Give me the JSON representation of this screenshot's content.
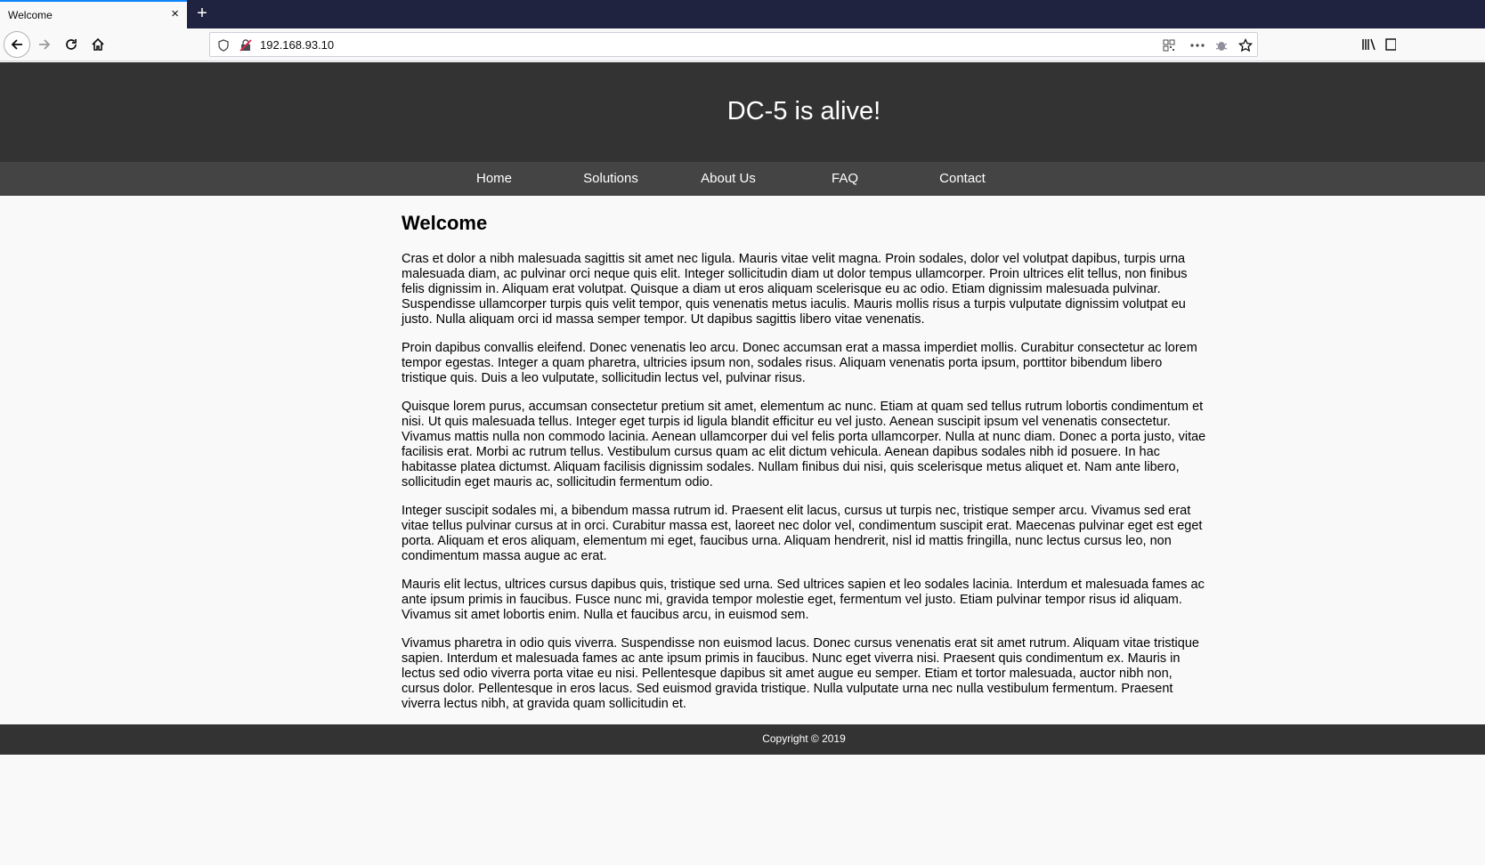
{
  "browser": {
    "tab_title": "Welcome",
    "tab_close": "×",
    "new_tab": "+",
    "url": "192.168.93.10",
    "icons": [
      "back-arrow-icon",
      "forward-arrow-icon",
      "reload-icon",
      "home-icon",
      "shield-icon",
      "insecure-lock-icon",
      "qr-code-icon",
      "more-icon",
      "bug-icon",
      "star-icon",
      "library-icon",
      "sidebar-icon"
    ]
  },
  "site": {
    "title": "DC-5 is alive!",
    "nav": [
      "Home",
      "Solutions",
      "About Us",
      "FAQ",
      "Contact"
    ],
    "heading": "Welcome",
    "paragraphs": [
      "Cras et dolor a nibh malesuada sagittis sit amet nec ligula. Mauris vitae velit magna. Proin sodales, dolor vel volutpat dapibus, turpis urna malesuada diam, ac pulvinar orci neque quis elit. Integer sollicitudin diam ut dolor tempus ullamcorper. Proin ultrices elit tellus, non finibus felis dignissim in. Aliquam erat volutpat. Quisque a diam ut eros aliquam scelerisque eu ac odio. Etiam dignissim malesuada pulvinar. Suspendisse ullamcorper turpis quis velit tempor, quis venenatis metus iaculis. Mauris mollis risus a turpis vulputate dignissim volutpat eu justo. Nulla aliquam orci id massa semper tempor. Ut dapibus sagittis libero vitae venenatis.",
      "Proin dapibus convallis eleifend. Donec venenatis leo arcu. Donec accumsan erat a massa imperdiet mollis. Curabitur consectetur ac lorem tempor egestas. Integer a quam pharetra, ultricies ipsum non, sodales risus. Aliquam venenatis porta ipsum, porttitor bibendum libero tristique quis. Duis a leo vulputate, sollicitudin lectus vel, pulvinar risus.",
      "Quisque lorem purus, accumsan consectetur pretium sit amet, elementum ac nunc. Etiam at quam sed tellus rutrum lobortis condimentum et nisi. Ut quis malesuada tellus. Integer eget turpis id ligula blandit efficitur eu vel justo. Aenean suscipit ipsum vel venenatis consectetur. Vivamus mattis nulla non commodo lacinia. Aenean ullamcorper dui vel felis porta ullamcorper. Nulla at nunc diam. Donec a porta justo, vitae facilisis erat. Morbi ac rutrum tellus. Vestibulum cursus quam ac elit dictum vehicula. Aenean dapibus sodales nibh id posuere. In hac habitasse platea dictumst. Aliquam facilisis dignissim sodales. Nullam finibus dui nisi, quis scelerisque metus aliquet et. Nam ante libero, sollicitudin eget mauris ac, sollicitudin fermentum odio.",
      "Integer suscipit sodales mi, a bibendum massa rutrum id. Praesent elit lacus, cursus ut turpis nec, tristique semper arcu. Vivamus sed erat vitae tellus pulvinar cursus at in orci. Curabitur massa est, laoreet nec dolor vel, condimentum suscipit erat. Maecenas pulvinar eget est eget porta. Aliquam et eros aliquam, elementum mi eget, faucibus urna. Aliquam hendrerit, nisl id mattis fringilla, nunc lectus cursus leo, non condimentum massa augue ac erat.",
      "Mauris elit lectus, ultrices cursus dapibus quis, tristique sed urna. Sed ultrices sapien et leo sodales lacinia. Interdum et malesuada fames ac ante ipsum primis in faucibus. Fusce nunc mi, gravida tempor molestie eget, fermentum vel justo. Etiam pulvinar tempor risus id aliquam. Vivamus sit amet lobortis enim. Nulla et faucibus arcu, in euismod sem.",
      "Vivamus pharetra in odio quis viverra. Suspendisse non euismod lacus. Donec cursus venenatis erat sit amet rutrum. Aliquam vitae tristique sapien. Interdum et malesuada fames ac ante ipsum primis in faucibus. Nunc eget viverra nisi. Praesent quis condimentum ex. Mauris in lectus sed odio viverra porta vitae eu nisi. Pellentesque dapibus sit amet augue eu semper. Etiam et tortor malesuada, auctor nibh non, cursus dolor. Pellentesque in eros lacus. Sed euismod gravida tristique. Nulla vulputate urna nec nulla vestibulum fermentum. Praesent viverra lectus nibh, at gravida quam sollicitudin et."
    ],
    "footer": "Copyright © 2019"
  },
  "colors": {
    "tabbar": "#202340",
    "header": "#333333",
    "nav": "#444444",
    "page_bg": "#f9f9f9",
    "accent": "#0a84ff"
  }
}
